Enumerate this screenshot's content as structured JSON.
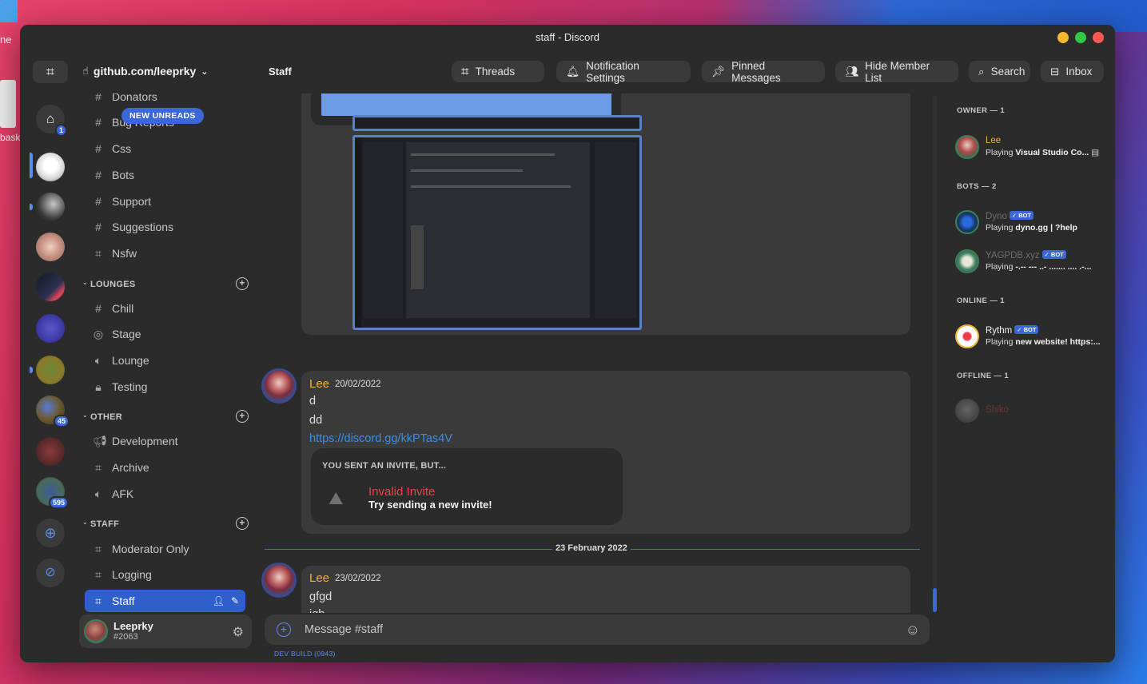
{
  "desktop": {
    "left_text_1": "ne",
    "left_text_2": "bask"
  },
  "window": {
    "title": "staff - Discord"
  },
  "topbar": {
    "server_name": "github.com/leeprky",
    "channel_title": "Staff",
    "buttons": {
      "threads": "Threads",
      "notification_settings": "Notification Settings",
      "pinned_messages": "Pinned Messages",
      "hide_member_list": "Hide Member List",
      "search": "Search",
      "inbox": "Inbox"
    }
  },
  "rail": {
    "home_badge": "1",
    "badge_45": "45",
    "badge_595": "595"
  },
  "channels": {
    "new_unreads": "NEW UNREADS",
    "top_partial": "Donators",
    "items_top": [
      {
        "icon": "#",
        "name": "Bug Reports"
      },
      {
        "icon": "#",
        "name": "Css"
      },
      {
        "icon": "#",
        "name": "Bots"
      },
      {
        "icon": "#",
        "name": "Support"
      },
      {
        "icon": "#",
        "name": "Suggestions"
      },
      {
        "icon": "⌗",
        "name": "Nsfw"
      }
    ],
    "categories": {
      "lounges": "LOUNGES",
      "other": "OTHER",
      "staff": "STAFF"
    },
    "lounges": [
      {
        "name": "Chill"
      },
      {
        "name": "Stage"
      },
      {
        "name": "Lounge"
      },
      {
        "name": "Testing"
      }
    ],
    "other": [
      {
        "name": "Development"
      },
      {
        "name": "Archive"
      },
      {
        "name": "AFK"
      }
    ],
    "staff": [
      {
        "name": "Moderator Only"
      },
      {
        "name": "Logging"
      },
      {
        "name": "Staff"
      }
    ]
  },
  "user": {
    "name": "Leeprky",
    "tag": "#2063"
  },
  "messages": [
    {
      "author": "Lee",
      "timestamp": "20/02/2022",
      "lines": [
        "d",
        "dd"
      ],
      "link": "https://discord.gg/kkPTas4V",
      "invite": {
        "header": "YOU SENT AN INVITE, BUT...",
        "title": "Invalid Invite",
        "subtitle": "Try sending a new invite!"
      }
    },
    {
      "author": "Lee",
      "timestamp": "23/02/2022",
      "lines": [
        "gfgd",
        "jgh"
      ]
    }
  ],
  "date_divider": "23 February 2022",
  "composer": {
    "placeholder": "Message #staff"
  },
  "dev_build": "DEV BUILD (0943)",
  "members": {
    "categories": {
      "owner": "OWNER — 1",
      "bots": "BOTS — 2",
      "online": "ONLINE — 1",
      "offline": "OFFLINE — 1"
    },
    "bot_badge": "✓ BOT",
    "owner": {
      "name": "Lee",
      "status_prefix": "Playing ",
      "status": "Visual Studio Co..."
    },
    "bots": [
      {
        "name": "Dyno",
        "status_prefix": "Playing ",
        "status": "dyno.gg | ?help"
      },
      {
        "name": "YAGPDB.xyz",
        "status_prefix": "Playing ",
        "status": "-.-- --- ..- ....... .... .-..."
      }
    ],
    "online": {
      "name": "Rythm",
      "status_prefix": "Playing ",
      "status": "new website! https:..."
    },
    "offline": {
      "name": "Shiko"
    }
  },
  "colors": {
    "accent": "#3b67d8",
    "author": "#f0b232",
    "error": "#ed4245",
    "link": "#3a8ee8"
  }
}
